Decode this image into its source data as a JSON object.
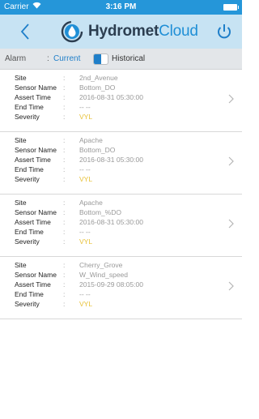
{
  "status_bar": {
    "carrier": "Carrier",
    "time": "3:16 PM",
    "icons": [
      "wifi-icon",
      "battery-icon"
    ]
  },
  "header": {
    "back_icon": "chevron-left-icon",
    "logo_text": "Hydromet",
    "logo_accent": "Cloud",
    "power_icon": "power-icon",
    "accent_color": "#1f8fd6"
  },
  "filter": {
    "alarm_label": "Alarm",
    "separator": ":",
    "current_label": "Current",
    "historical_label": "Historical",
    "toggle_state": "current"
  },
  "field_labels": {
    "site": "Site",
    "sensor_name": "Sensor Name",
    "assert_time": "Assert Time",
    "end_time": "End Time",
    "severity": "Severity",
    "colon": ":"
  },
  "alarms": [
    {
      "site": "2nd_Avenue",
      "sensor_name": "Bottom_DO",
      "assert_time": "2016-08-31 05:30:00",
      "end_time": "-- --",
      "severity": "VYL"
    },
    {
      "site": "Apache",
      "sensor_name": "Bottom_DO",
      "assert_time": "2016-08-31 05:30:00",
      "end_time": "-- --",
      "severity": "VYL"
    },
    {
      "site": "Apache",
      "sensor_name": "Bottom_%DO",
      "assert_time": "2016-08-31 05:30:00",
      "end_time": "-- --",
      "severity": "VYL"
    },
    {
      "site": "Cherry_Grove",
      "sensor_name": "W_Wind_speed",
      "assert_time": "2015-09-29 08:05:00",
      "end_time": "-- --",
      "severity": "VYL"
    }
  ],
  "colors": {
    "status_bar": "#2596d9",
    "navbar": "#c7e3f3",
    "severity": "#e8c23a"
  }
}
